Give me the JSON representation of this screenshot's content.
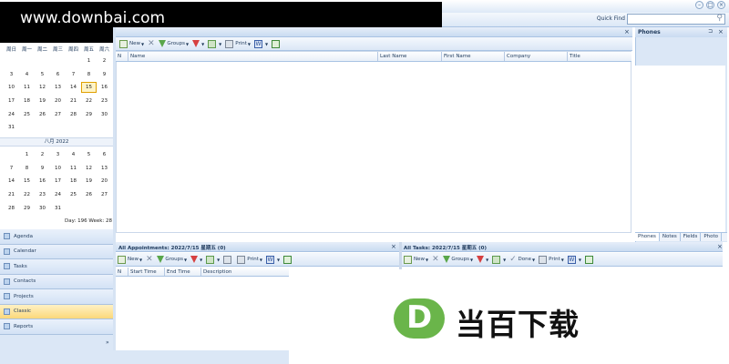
{
  "watermark": {
    "text": "www.downbai.com",
    "logo_letter": "D",
    "logo_text": "当百下载"
  },
  "window": {
    "controls": [
      "–",
      "□",
      "×"
    ]
  },
  "quickfind": {
    "label": "Quick Find"
  },
  "calendar1": {
    "weekdays": [
      "周日",
      "周一",
      "周二",
      "周三",
      "周四",
      "周五",
      "周六"
    ],
    "rows": [
      [
        "",
        "",
        "",
        "",
        "",
        "1",
        "2"
      ],
      [
        "3",
        "4",
        "5",
        "6",
        "7",
        "8",
        "9"
      ],
      [
        "10",
        "11",
        "12",
        "13",
        "14",
        "15",
        "16"
      ],
      [
        "17",
        "18",
        "19",
        "20",
        "21",
        "22",
        "23"
      ],
      [
        "24",
        "25",
        "26",
        "27",
        "28",
        "29",
        "30"
      ],
      [
        "31",
        "",
        "",
        "",
        "",
        "",
        ""
      ]
    ],
    "today": "15"
  },
  "calendar2": {
    "title": "八月 2022",
    "rows": [
      [
        "",
        "1",
        "2",
        "3",
        "4",
        "5",
        "6"
      ],
      [
        "7",
        "8",
        "9",
        "10",
        "11",
        "12",
        "13"
      ],
      [
        "14",
        "15",
        "16",
        "17",
        "18",
        "19",
        "20"
      ],
      [
        "21",
        "22",
        "23",
        "24",
        "25",
        "26",
        "27"
      ],
      [
        "28",
        "29",
        "30",
        "31",
        "",
        "",
        ""
      ]
    ]
  },
  "status": {
    "day_week": "Day: 196  Week: 28"
  },
  "nav": {
    "items": [
      "Agenda",
      "Calendar",
      "Tasks",
      "Contacts",
      "Projects",
      "Classic",
      "Reports"
    ],
    "active": "Classic",
    "more": "»"
  },
  "contacts": {
    "close": "×",
    "toolbar": {
      "new": "New",
      "groups": "Groups",
      "print": "Print"
    },
    "columns": [
      "N",
      "Name",
      "Last Name",
      "First Name",
      "Company",
      "Title"
    ]
  },
  "phones": {
    "title": "Phones",
    "pin": "⊐",
    "close": "×",
    "tabs": [
      "Phones",
      "Notes",
      "Fields",
      "Photo"
    ],
    "active_tab": "Phones"
  },
  "appointments": {
    "title": "All Appointments: 2022/7/15 星期五  (0)",
    "close": "×",
    "toolbar": {
      "new": "New",
      "groups": "Groups",
      "print": "Print"
    },
    "columns": [
      "N",
      "Start Time",
      "End Time",
      "Description"
    ]
  },
  "tasks": {
    "title": "All Tasks: 2022/7/15 星期五  (0)",
    "close": "×",
    "toolbar": {
      "new": "New",
      "groups": "Groups",
      "done": "Done",
      "print": "Print"
    }
  }
}
